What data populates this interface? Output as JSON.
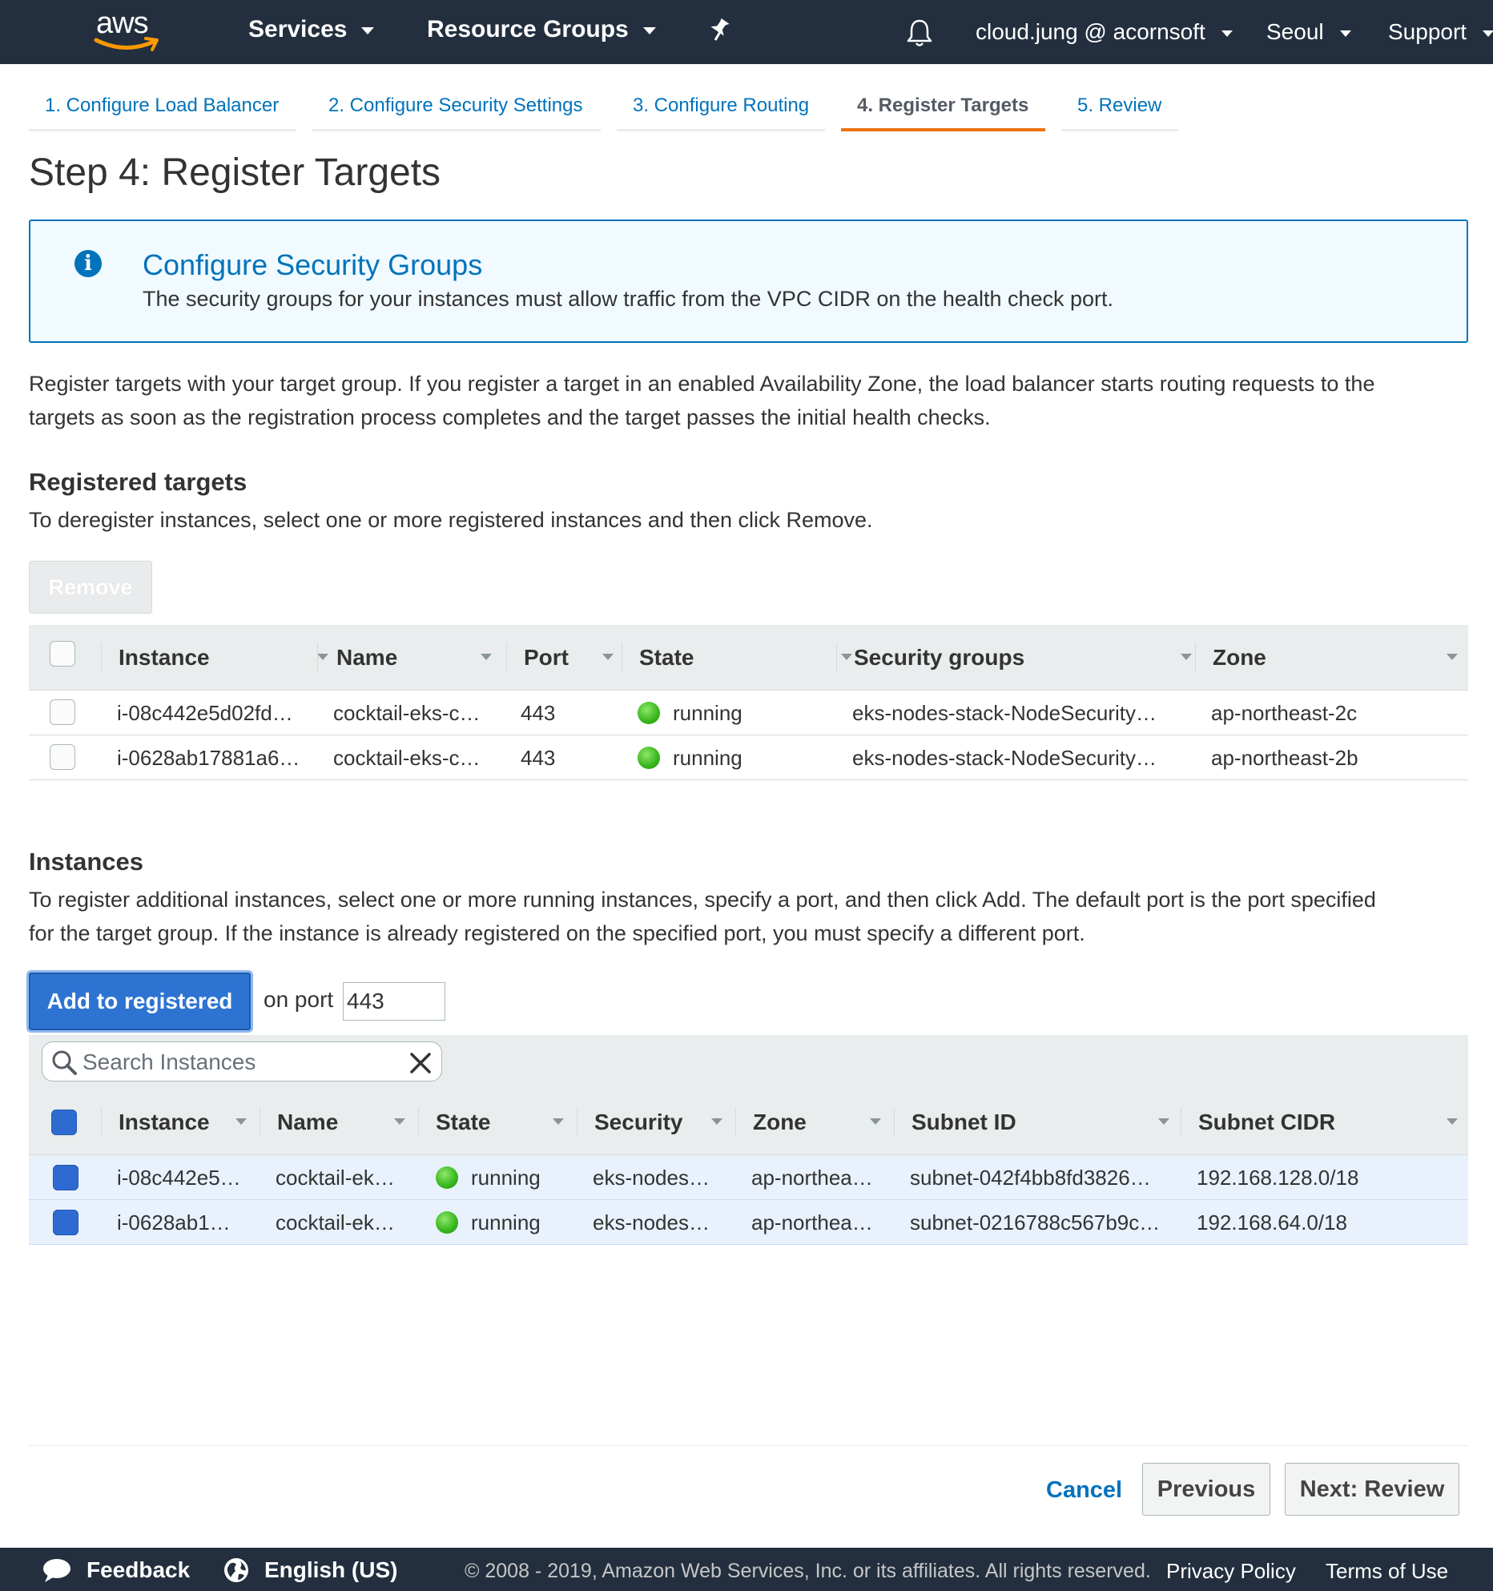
{
  "topnav": {
    "logo": "aws",
    "services": "Services",
    "resource_groups": "Resource Groups",
    "pin_icon": "pin-icon",
    "bell_icon": "bell-icon",
    "account": "cloud.jung @ acornsoft",
    "region": "Seoul",
    "support": "Support"
  },
  "wizard": {
    "tabs": [
      {
        "label": "1. Configure Load Balancer",
        "active": false
      },
      {
        "label": "2. Configure Security Settings",
        "active": false
      },
      {
        "label": "3. Configure Routing",
        "active": false
      },
      {
        "label": "4. Register Targets",
        "active": true
      },
      {
        "label": "5. Review",
        "active": false
      }
    ]
  },
  "page_title": "Step 4: Register Targets",
  "info": {
    "icon": "info-icon",
    "title": "Configure Security Groups",
    "description": "The security groups for your instances must allow traffic from the VPC CIDR on the health check port."
  },
  "intro": {
    "line1": "Register targets with your target group. If you register a target in an enabled Availability Zone, the load balancer starts routing requests to the",
    "line2": "targets as soon as the registration process completes and the target passes the initial health checks."
  },
  "registered": {
    "heading": "Registered targets",
    "description": "To deregister instances, select one or more registered instances and then click Remove.",
    "remove_label": "Remove",
    "columns": [
      "Instance",
      "Name",
      "Port",
      "State",
      "Security groups",
      "Zone"
    ],
    "rows": [
      {
        "instance": "i-08c442e5d02fd…",
        "name": "cocktail-eks-c…",
        "port": "443",
        "state": "running",
        "security": "eks-nodes-stack-NodeSecurity…",
        "zone": "ap-northeast-2c"
      },
      {
        "instance": "i-0628ab17881a6…",
        "name": "cocktail-eks-c…",
        "port": "443",
        "state": "running",
        "security": "eks-nodes-stack-NodeSecurity…",
        "zone": "ap-northeast-2b"
      }
    ]
  },
  "instances": {
    "heading": "Instances",
    "line1": "To register additional instances, select one or more running instances, specify a port, and then click Add. The default port is the port specified",
    "line2": "for the target group. If the instance is already registered on the specified port, you must specify a different port.",
    "add_label": "Add to registered",
    "on_port_label": "on port",
    "port_value": "443",
    "search_placeholder": "Search Instances",
    "columns": [
      "Instance",
      "Name",
      "State",
      "Security",
      "Zone",
      "Subnet ID",
      "Subnet CIDR"
    ],
    "rows": [
      {
        "instance": "i-08c442e5…",
        "name": "cocktail-ek…",
        "state": "running",
        "security": "eks-nodes…",
        "zone": "ap-northea…",
        "subnet_id": "subnet-042f4bb8fd3826…",
        "cidr": "192.168.128.0/18"
      },
      {
        "instance": "i-0628ab1…",
        "name": "cocktail-ek…",
        "state": "running",
        "security": "eks-nodes…",
        "zone": "ap-northea…",
        "subnet_id": "subnet-0216788c567b9c…",
        "cidr": "192.168.64.0/18"
      }
    ]
  },
  "actions": {
    "cancel": "Cancel",
    "previous": "Previous",
    "next": "Next: Review"
  },
  "footer": {
    "feedback": "Feedback",
    "language": "English (US)",
    "copyright": "© 2008 - 2019, Amazon Web Services, Inc. or its affiliates. All rights reserved.",
    "privacy": "Privacy Policy",
    "terms": "Terms of Use"
  },
  "colors": {
    "nav_bg": "#232f3e",
    "link": "#0073bb",
    "active_tab": "#ec7211",
    "primary_button": "#2d74d2",
    "running": "#35b51b"
  }
}
